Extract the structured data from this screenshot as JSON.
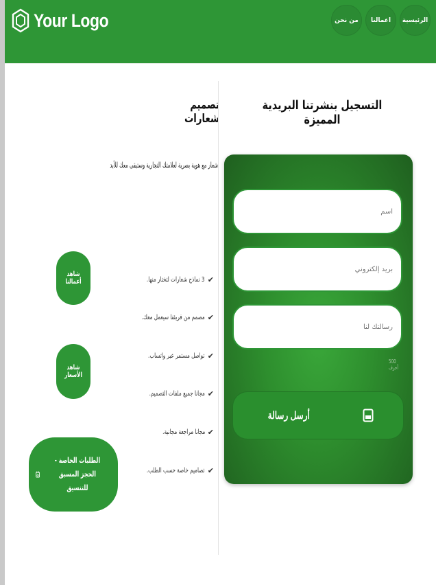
{
  "header": {
    "logo_text": "Your Logo",
    "nav": [
      {
        "label": "الرئيسية"
      },
      {
        "label": "اعمالنا"
      },
      {
        "label": "من نحن"
      }
    ]
  },
  "newsletter": {
    "title": "التسجيل بنشرتنا البريدية المميزة",
    "name_placeholder": "اسم",
    "email_placeholder": "بريد إلكتروني",
    "message_placeholder": "رسالتك لنا",
    "max_note": "500 أحرف",
    "send_label": "أرسل رسالة",
    "send_icon": "document-icon"
  },
  "logo_design": {
    "title": "تصميم شعارات",
    "subtitle": "شعار مع هوية بصرية لعلامتك التجارية وستبقى معك للأبد",
    "features": [
      "3 نماذج شعارات لتختار منها.",
      "مصمم من فريقنا سيعمل معك.",
      "تواصل مستمر عبر واتساب.",
      "مجانا جميع ملفات التصميم.",
      "مجانا مراجعة مجانية.",
      "تصاميم خاصة حسب الطلب."
    ],
    "works_button": "شاهد أعمالنا",
    "prices_button": "شاهد الأسعار",
    "special_button": "الطلبات الخاصة - الحجز المسبق للتنسيق",
    "special_icon": "calendar-icon"
  },
  "colors": {
    "brand_green": "#2e9636",
    "card_dark": "#1f5f1f"
  }
}
